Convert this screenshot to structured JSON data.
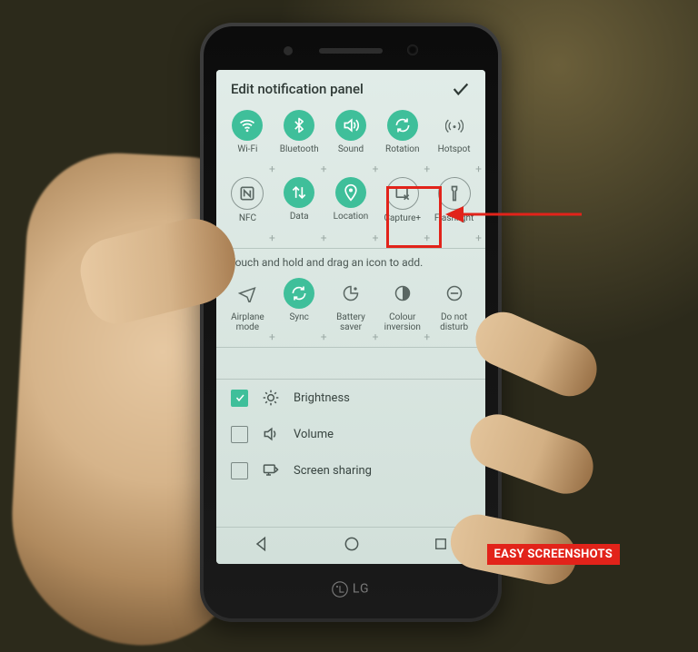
{
  "device": {
    "brand": " LG"
  },
  "header": {
    "title": "Edit notification panel"
  },
  "hint": "Touch and hold and drag an icon to add.",
  "watermark": "EASY SCREENSHOTS",
  "active_tiles": [
    {
      "id": "wifi",
      "label": "Wi-Fi",
      "icon": "wifi",
      "style": "on"
    },
    {
      "id": "bluetooth",
      "label": "Bluetooth",
      "icon": "bluetooth",
      "style": "on"
    },
    {
      "id": "sound",
      "label": "Sound",
      "icon": "sound",
      "style": "on"
    },
    {
      "id": "rotation",
      "label": "Rotation",
      "icon": "rotation",
      "style": "on"
    },
    {
      "id": "hotspot",
      "label": "Hotspot",
      "icon": "hotspot",
      "style": "outline"
    },
    {
      "id": "nfc",
      "label": "NFC",
      "icon": "nfc",
      "style": "off"
    },
    {
      "id": "data",
      "label": "Data",
      "icon": "data",
      "style": "on"
    },
    {
      "id": "location",
      "label": "Location",
      "icon": "location",
      "style": "on"
    },
    {
      "id": "capture",
      "label": "Capture+",
      "icon": "capture",
      "style": "off"
    },
    {
      "id": "flashlight",
      "label": "Flashlight",
      "icon": "flashlight",
      "style": "off"
    }
  ],
  "available_tiles": [
    {
      "id": "airplane",
      "label": "Airplane\nmode",
      "icon": "airplane",
      "style": "outline"
    },
    {
      "id": "sync",
      "label": "Sync",
      "icon": "sync",
      "style": "on"
    },
    {
      "id": "battery",
      "label": "Battery\nsaver",
      "icon": "battery",
      "style": "outline"
    },
    {
      "id": "invert",
      "label": "Colour\ninversion",
      "icon": "invert",
      "style": "outline"
    },
    {
      "id": "dnd",
      "label": "Do not\ndisturb",
      "icon": "dnd",
      "style": "outline"
    }
  ],
  "sliders": [
    {
      "id": "brightness",
      "label": "Brightness",
      "icon": "brightness",
      "checked": true
    },
    {
      "id": "volume",
      "label": "Volume",
      "icon": "volume",
      "checked": false
    },
    {
      "id": "screenshare",
      "label": "Screen sharing",
      "icon": "screenshare",
      "checked": false
    }
  ]
}
